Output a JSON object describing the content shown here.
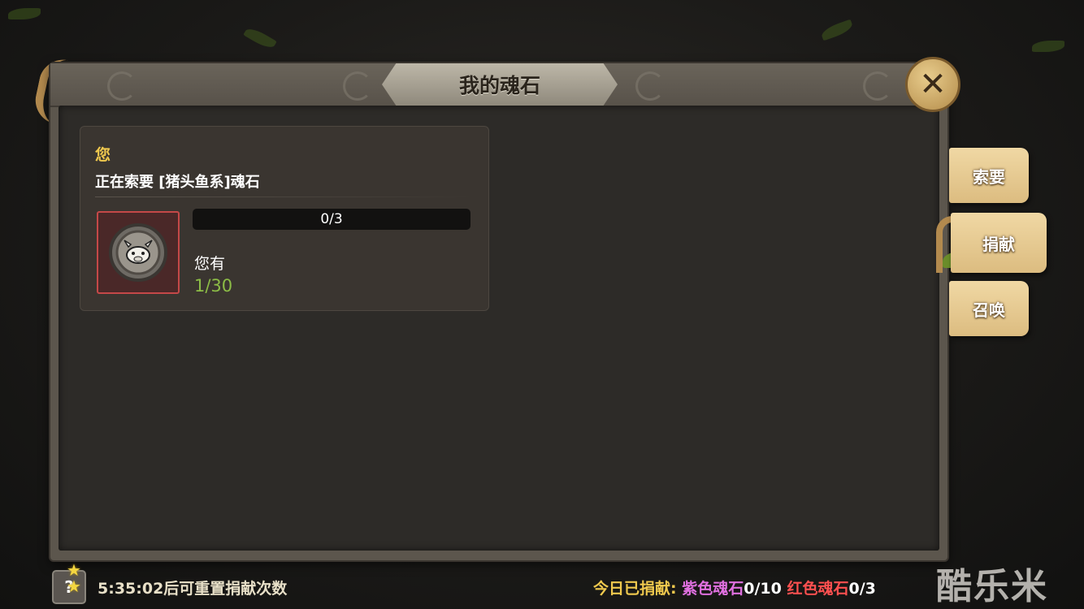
{
  "window": {
    "title": "我的魂石"
  },
  "request_card": {
    "who": "您",
    "message": "正在索要 [猪头鱼系]魂石",
    "progress_text": "0/3",
    "progress_fraction": 0.0,
    "own_label": "您有",
    "own_value": "1/30"
  },
  "tabs": [
    {
      "label": "索要",
      "active": false
    },
    {
      "label": "捐献",
      "active": true
    },
    {
      "label": "召唤",
      "active": false
    }
  ],
  "footer": {
    "help_label": "?",
    "reset_timer": "5:35:02后可重置捐献次数",
    "today_label": "今日已捐献:",
    "purple_label": "紫色魂石",
    "purple_count": "0/10",
    "red_label": "红色魂石",
    "red_count": "0/3"
  },
  "icons": {
    "close": "close-x-icon",
    "stone": "boar-soulstone-icon",
    "stars": "star-icon"
  },
  "watermark": "酷乐米",
  "colors": {
    "accent_gold": "#f0c94e",
    "own_value_green": "#8cbc46",
    "purple": "#e070e0",
    "red": "#ff5050",
    "slot_border": "#c44848"
  }
}
